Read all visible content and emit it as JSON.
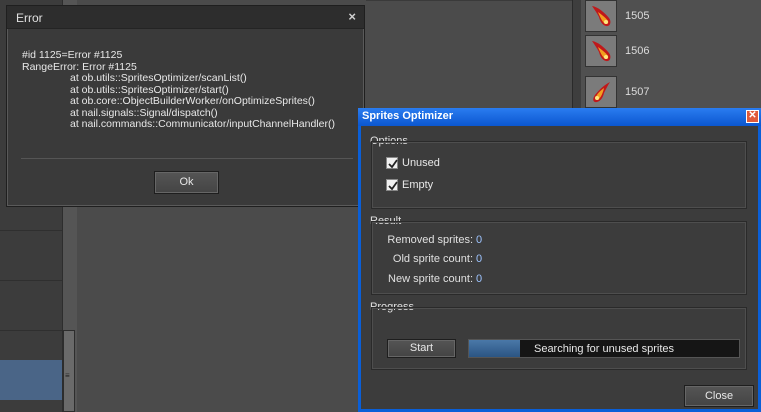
{
  "error_dialog": {
    "title": "Error",
    "close_glyph": "×",
    "message_lines": [
      "#id 1125=Error #1125",
      "RangeError: Error #1125"
    ],
    "stack_lines": [
      "at ob.utils::SpritesOptimizer/scanList()",
      "at ob.utils::SpritesOptimizer/start()",
      "at ob.core::ObjectBuilderWorker/onOptimizeSprites()",
      "at nail.signals::Signal/dispatch()",
      "at nail.commands::Communicator/inputChannelHandler()"
    ],
    "ok_label": "Ok"
  },
  "sprite_list": {
    "items": [
      {
        "id": "1505",
        "icon": "fireball-icon"
      },
      {
        "id": "1506",
        "icon": "fireball-icon"
      },
      {
        "id": "1507",
        "icon": "fireball-icon"
      }
    ]
  },
  "optimizer": {
    "title": "Sprites Optimizer",
    "close_glyph": "✕",
    "options": {
      "label": "Options",
      "unused_label": "Unused",
      "unused_checked": true,
      "empty_label": "Empty",
      "empty_checked": true
    },
    "result": {
      "label": "Result",
      "removed_label": "Removed sprites:",
      "removed_value": "0",
      "old_label": "Old sprite count:",
      "old_value": "0",
      "new_label": "New sprite count:",
      "new_value": "0"
    },
    "progress": {
      "label": "Progress",
      "start_label": "Start",
      "status_text": "Searching for unused sprites",
      "fraction": 0.19
    },
    "close_label": "Close"
  },
  "colors": {
    "title_bar_blue": "#0b57d0",
    "value_blue": "#9ec4ff",
    "progress_fill": "#2b5583"
  }
}
